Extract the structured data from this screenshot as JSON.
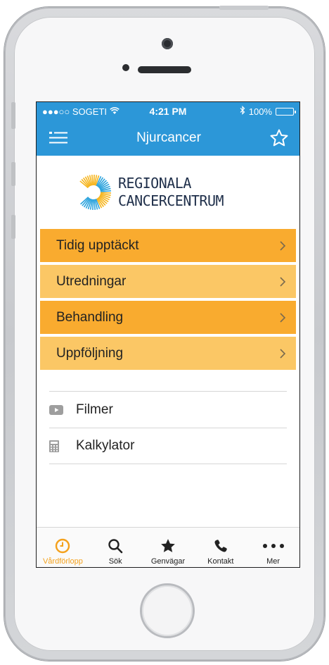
{
  "status_bar": {
    "carrier": "●●●○○ SOGETI",
    "time": "4:21 PM",
    "battery": "100%"
  },
  "nav": {
    "title": "Njurcancer",
    "menu_icon": "hamburger-icon",
    "favorite_icon": "star-outline-icon"
  },
  "logo": {
    "line1": "REGIONALA",
    "line2": "CANCERCENTRUM"
  },
  "menu": [
    {
      "label": "Tidig upptäckt",
      "color": "#f9ab2f"
    },
    {
      "label": "Utredningar",
      "color": "#fbc765"
    },
    {
      "label": "Behandling",
      "color": "#f9ab2f"
    },
    {
      "label": "Uppföljning",
      "color": "#fbc765"
    }
  ],
  "links": [
    {
      "label": "Filmer",
      "icon": "video-icon"
    },
    {
      "label": "Kalkylator",
      "icon": "calculator-icon"
    }
  ],
  "tabs": [
    {
      "label": "Vårdförlopp",
      "icon": "clock-icon",
      "active": true
    },
    {
      "label": "Sök",
      "icon": "search-icon",
      "active": false
    },
    {
      "label": "Genvägar",
      "icon": "star-icon",
      "active": false
    },
    {
      "label": "Kontakt",
      "icon": "phone-icon",
      "active": false
    },
    {
      "label": "Mer",
      "icon": "more-icon",
      "active": false
    }
  ],
  "colors": {
    "header": "#2c97d8",
    "accent_active_tab": "#f4a11c"
  }
}
